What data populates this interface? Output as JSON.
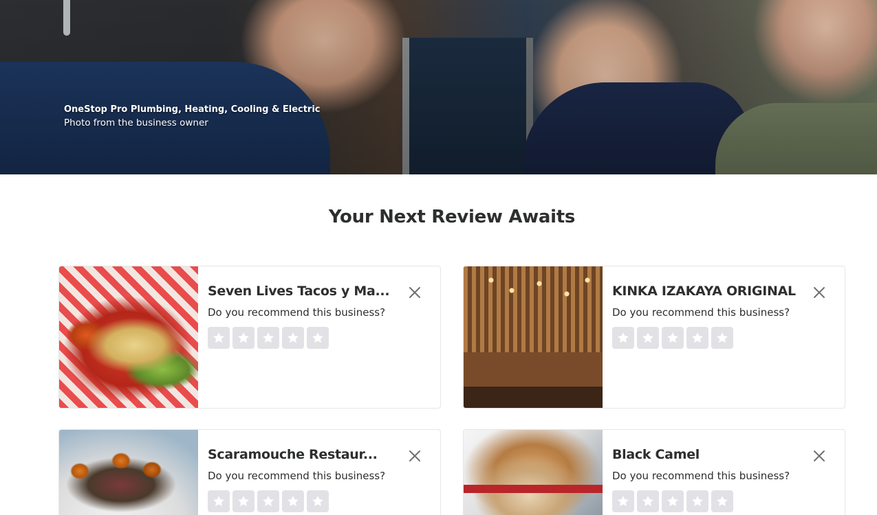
{
  "hero": {
    "business_name": "OneStop Pro Plumbing, Heating, Cooling & Electric",
    "photo_credit": "Photo from the business owner"
  },
  "section": {
    "title": "Your Next Review Awaits"
  },
  "cards": [
    {
      "name": "Seven Lives Tacos y Ma...",
      "prompt": "Do you recommend this business?"
    },
    {
      "name": "KINKA IZAKAYA ORIGINAL",
      "prompt": "Do you recommend this business?"
    },
    {
      "name": "Scaramouche Restaur...",
      "prompt": "Do you recommend this business?"
    },
    {
      "name": "Black Camel",
      "prompt": "Do you recommend this business?"
    }
  ],
  "icons": {
    "close": "close-icon",
    "star": "star-icon"
  },
  "colors": {
    "star_empty_bg": "#e2e2e6",
    "text": "#2d2e2f",
    "card_border": "#e6e6e6"
  }
}
